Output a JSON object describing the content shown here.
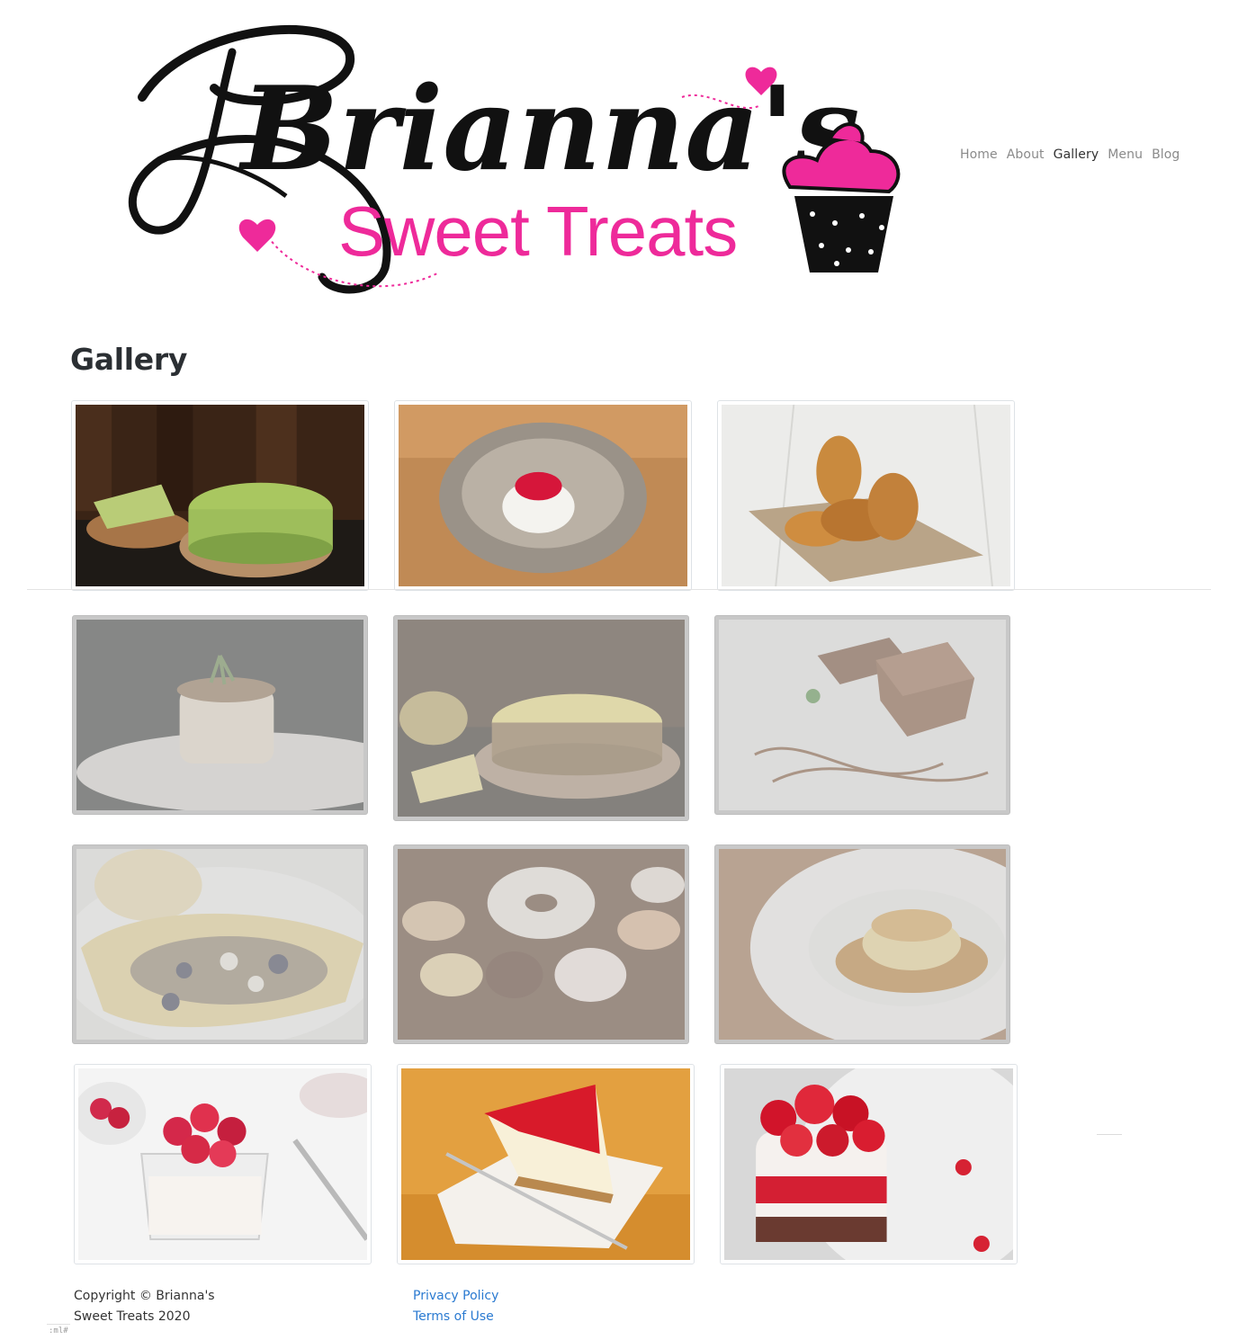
{
  "header": {
    "logo_script": "Brianna's",
    "logo_sub": "Sweet Treats",
    "nav": [
      {
        "label": "Home"
      },
      {
        "label": "About"
      },
      {
        "label": "Gallery"
      },
      {
        "label": "Menu"
      },
      {
        "label": "Blog"
      }
    ],
    "active_nav": "Gallery"
  },
  "page_title": "Gallery",
  "gallery": {
    "items": [
      {
        "subject": "matcha cake",
        "state": "normal"
      },
      {
        "subject": "panna cotta with berry sauce",
        "state": "normal"
      },
      {
        "subject": "croissants",
        "state": "normal"
      },
      {
        "subject": "tiramisu slice",
        "state": "faded"
      },
      {
        "subject": "lemon cheesecake",
        "state": "faded"
      },
      {
        "subject": "chocolate brownies",
        "state": "faded"
      },
      {
        "subject": "crepe with fruit",
        "state": "faded"
      },
      {
        "subject": "donuts and macarons",
        "state": "faded"
      },
      {
        "subject": "flan caramel pudding",
        "state": "faded"
      },
      {
        "subject": "raspberry chia pudding",
        "state": "normal"
      },
      {
        "subject": "strawberry cheesecake slice",
        "state": "normal"
      },
      {
        "subject": "strawberry cream cake",
        "state": "normal"
      }
    ]
  },
  "footer": {
    "copyright": "Copyright © Brianna's Sweet Treats 2020",
    "links": [
      {
        "label": "Privacy Policy"
      },
      {
        "label": "Terms of Use"
      }
    ]
  },
  "corner_tag": ":ml#",
  "colors": {
    "brand_pink": "#ee2a9a",
    "logo_black": "#111111",
    "link_blue": "#2a7ad1",
    "nav_gray": "#8a8a8a"
  }
}
